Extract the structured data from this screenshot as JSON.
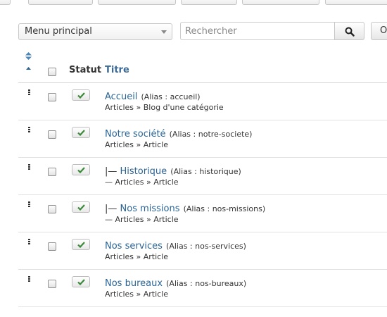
{
  "filter": {
    "menu_selected": "Menu principal"
  },
  "search": {
    "placeholder": "Rechercher",
    "options_label": "O"
  },
  "table": {
    "headers": {
      "status": "Statut",
      "title": "Titre"
    },
    "status_color": "#3a8a3a",
    "link_color": "#2a6496",
    "rows": [
      {
        "prefix": "",
        "title": "Accueil",
        "alias": "(Alias : accueil)",
        "sub": "Articles » Blog d'une catégorie"
      },
      {
        "prefix": "",
        "title": "Notre société",
        "alias": "(Alias : notre-societe)",
        "sub": "Articles » Article"
      },
      {
        "prefix": "|— ",
        "title": "Historique",
        "alias": "(Alias : historique)",
        "sub": "— Articles » Article"
      },
      {
        "prefix": "|— ",
        "title": "Nos missions",
        "alias": "(Alias : nos-missions)",
        "sub": "— Articles » Article"
      },
      {
        "prefix": "",
        "title": "Nos services",
        "alias": "(Alias : nos-services)",
        "sub": "Articles » Article"
      },
      {
        "prefix": "",
        "title": "Nos bureaux",
        "alias": "(Alias : nos-bureaux)",
        "sub": "Articles » Article"
      }
    ]
  }
}
